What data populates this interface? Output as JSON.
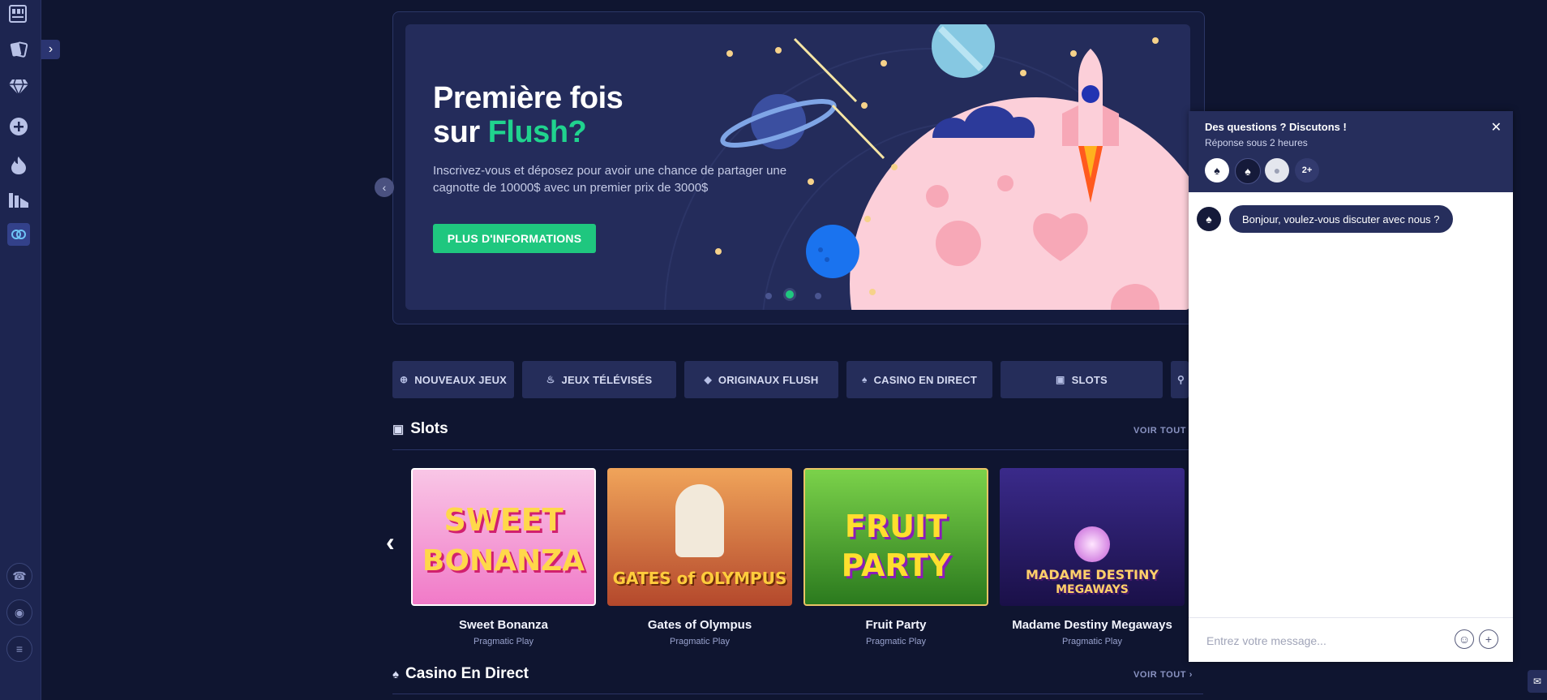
{
  "banner": {
    "title_line1": "Première fois",
    "title_line2_prefix": "sur ",
    "title_line2_accent": "Flush?",
    "description": "Inscrivez-vous et déposez pour avoir une chance de partager une cagnotte de 10000$ avec un premier prix de 3000$",
    "cta": "PLUS D'INFORMATIONS",
    "accent_color": "#20d38e"
  },
  "tabs": [
    {
      "label": "NOUVEAUX JEUX",
      "icon": "plus-circle-icon"
    },
    {
      "label": "JEUX TÉLÉVISÉS",
      "icon": "flame-icon"
    },
    {
      "label": "ORIGINAUX FLUSH",
      "icon": "diamond-icon"
    },
    {
      "label": "CASINO EN DIRECT",
      "icon": "cards-icon"
    },
    {
      "label": "SLOTS",
      "icon": "slot-machine-icon"
    }
  ],
  "slots": {
    "title": "Slots",
    "see_all": "VOIR TOUT",
    "games": [
      {
        "name": "Sweet Bonanza",
        "provider": "Pragmatic Play",
        "thumb_text_1": "SWEET",
        "thumb_text_2": "BONANZA"
      },
      {
        "name": "Gates of Olympus",
        "provider": "Pragmatic Play",
        "thumb_text_1": "GATES of OLYMPUS",
        "thumb_text_2": ""
      },
      {
        "name": "Fruit Party",
        "provider": "Pragmatic Play",
        "thumb_text_1": "FRUIT",
        "thumb_text_2": "PARTY"
      },
      {
        "name": "Madame Destiny Megaways",
        "provider": "Pragmatic Play",
        "thumb_text_1": "MADAME DESTINY",
        "thumb_text_2": "MEGAWAYS"
      }
    ]
  },
  "live": {
    "title": "Casino En Direct",
    "see_all": "VOIR TOUT"
  },
  "chat": {
    "title": "Des questions ? Discutons !",
    "subtitle": "Réponse sous 2 heures",
    "more_agents": "2+",
    "message": "Bonjour, voulez-vous discuter avec nous ?",
    "input_placeholder": "Entrez votre message..."
  }
}
